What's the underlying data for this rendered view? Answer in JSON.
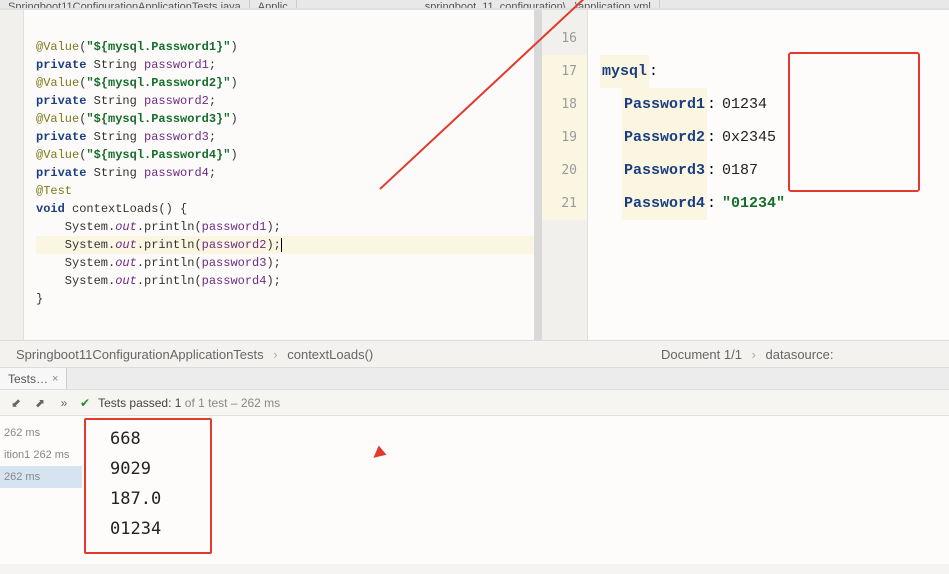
{
  "tabs": {
    "left": "Springboot11ConfigurationApplicationTests.java",
    "mid": "Applic",
    "right": "springboot_11_configuration\\...\\application.yml"
  },
  "java": {
    "l1a": "@Value",
    "l1b": "(",
    "l1c": "\"${mysql.Password1}\"",
    "l1d": ")",
    "l2a": "private",
    "l2b": " String ",
    "l2c": "password1",
    "l2d": ";",
    "l3a": "@Value",
    "l3b": "(",
    "l3c": "\"${mysql.Password2}\"",
    "l3d": ")",
    "l4a": "private",
    "l4b": " String ",
    "l4c": "password2",
    "l4d": ";",
    "l5a": "@Value",
    "l5b": "(",
    "l5c": "\"${mysql.Password3}\"",
    "l5d": ")",
    "l6a": "private",
    "l6b": " String ",
    "l6c": "password3",
    "l6d": ";",
    "l7a": "@Value",
    "l7b": "(",
    "l7c": "\"${mysql.Password4}\"",
    "l7d": ")",
    "l8a": "private",
    "l8b": " String ",
    "l8c": "password4",
    "l8d": ";",
    "l9": "@Test",
    "l10a": "void",
    "l10b": " contextLoads() {",
    "l11a": "    System.",
    "l11b": "out",
    "l11c": ".println(",
    "l11d": "password1",
    "l11e": ");",
    "l12a": "    System.",
    "l12b": "out",
    "l12c": ".println(",
    "l12d": "password2",
    "l12e": ");",
    "l13a": "    System.",
    "l13b": "out",
    "l13c": ".println(",
    "l13d": "password3",
    "l13e": ");",
    "l14a": "    System.",
    "l14b": "out",
    "l14c": ".println(",
    "l14d": "password4",
    "l14e": ");",
    "l15": "}"
  },
  "linenums": [
    "16",
    "17",
    "18",
    "19",
    "20",
    "21"
  ],
  "yaml": {
    "r1": "",
    "r2k": "mysql",
    "r2c": ":",
    "r3k": "Password1",
    "r3c": ":",
    "r3v": "01234",
    "r4k": "Password2",
    "r4c": ":",
    "r4v": "0x2345",
    "r5k": "Password3",
    "r5c": ":",
    "r5v": "0187",
    "r6k": "Password4",
    "r6c": ":",
    "r6v": "\"01234\""
  },
  "breadcrumb_left": {
    "a": "Springboot11ConfigurationApplicationTests",
    "sep": " › ",
    "b": "contextLoads()"
  },
  "breadcrumb_right": {
    "a": "Document 1/1",
    "sep": " › ",
    "b": "datasource:"
  },
  "runtab": "Tests…",
  "toolbar": {
    "chevrons": "»",
    "status": "Tests passed: 1",
    "status2": " of 1 test – 262 ms"
  },
  "tree": {
    "t1": "262 ms",
    "t2": "ition1 262 ms",
    "t3": "262 ms"
  },
  "output": {
    "o1": "668",
    "o2": "9029",
    "o3": "187.0",
    "o4": "01234"
  }
}
